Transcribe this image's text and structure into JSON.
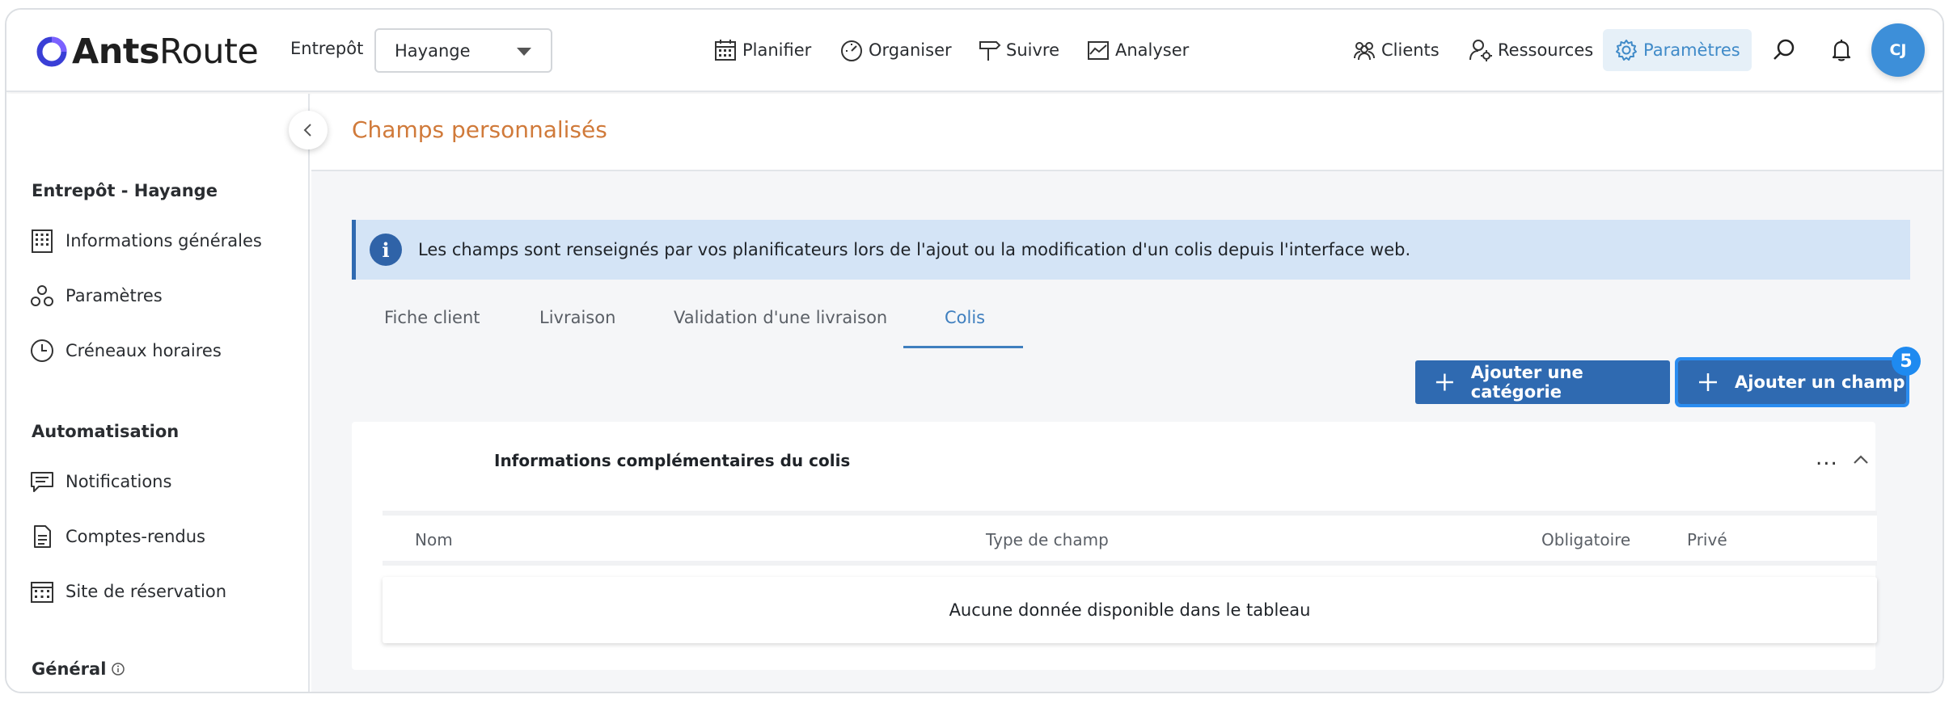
{
  "header": {
    "logo_ants": "Ants",
    "logo_route": "Route",
    "entrepot_label": "Entrepôt",
    "entrepot_value": "Hayange",
    "nav": [
      {
        "label": "Planifier"
      },
      {
        "label": "Organiser"
      },
      {
        "label": "Suivre"
      },
      {
        "label": "Analyser"
      }
    ],
    "right_nav": [
      {
        "label": "Clients"
      },
      {
        "label": "Ressources"
      },
      {
        "label": "Paramètres"
      }
    ],
    "avatar_initials": "CJ"
  },
  "sidebar": {
    "section1": "Entrepôt - Hayange",
    "items1": [
      {
        "label": "Informations générales"
      },
      {
        "label": "Paramètres"
      },
      {
        "label": "Créneaux horaires"
      }
    ],
    "section2": "Automatisation",
    "items2": [
      {
        "label": "Notifications"
      },
      {
        "label": "Comptes-rendus"
      },
      {
        "label": "Site de réservation"
      }
    ],
    "section3": "Général"
  },
  "page": {
    "title": "Champs personnalisés",
    "info_message": "Les champs sont renseignés par vos planificateurs lors de l'ajout ou la modification d'un colis depuis l'interface web.",
    "tabs": [
      {
        "label": "Fiche client"
      },
      {
        "label": "Livraison"
      },
      {
        "label": "Validation d'une livraison"
      },
      {
        "label": "Colis"
      }
    ],
    "active_tab": "Colis",
    "add_category_label": "Ajouter une catégorie",
    "add_field_label": "Ajouter un champ",
    "badge_count": "5",
    "card": {
      "title": "Informations complémentaires du colis",
      "menu": "...",
      "columns": [
        "Nom",
        "Type de champ",
        "Obligatoire",
        "Privé"
      ],
      "empty_message": "Aucune donnée disponible dans le tableau"
    }
  },
  "colors": {
    "accent": "#2f6ab1",
    "title_orange": "#d07a3a",
    "banner_bg": "#d4e4f6",
    "active_nav": "#3f8ac8"
  }
}
